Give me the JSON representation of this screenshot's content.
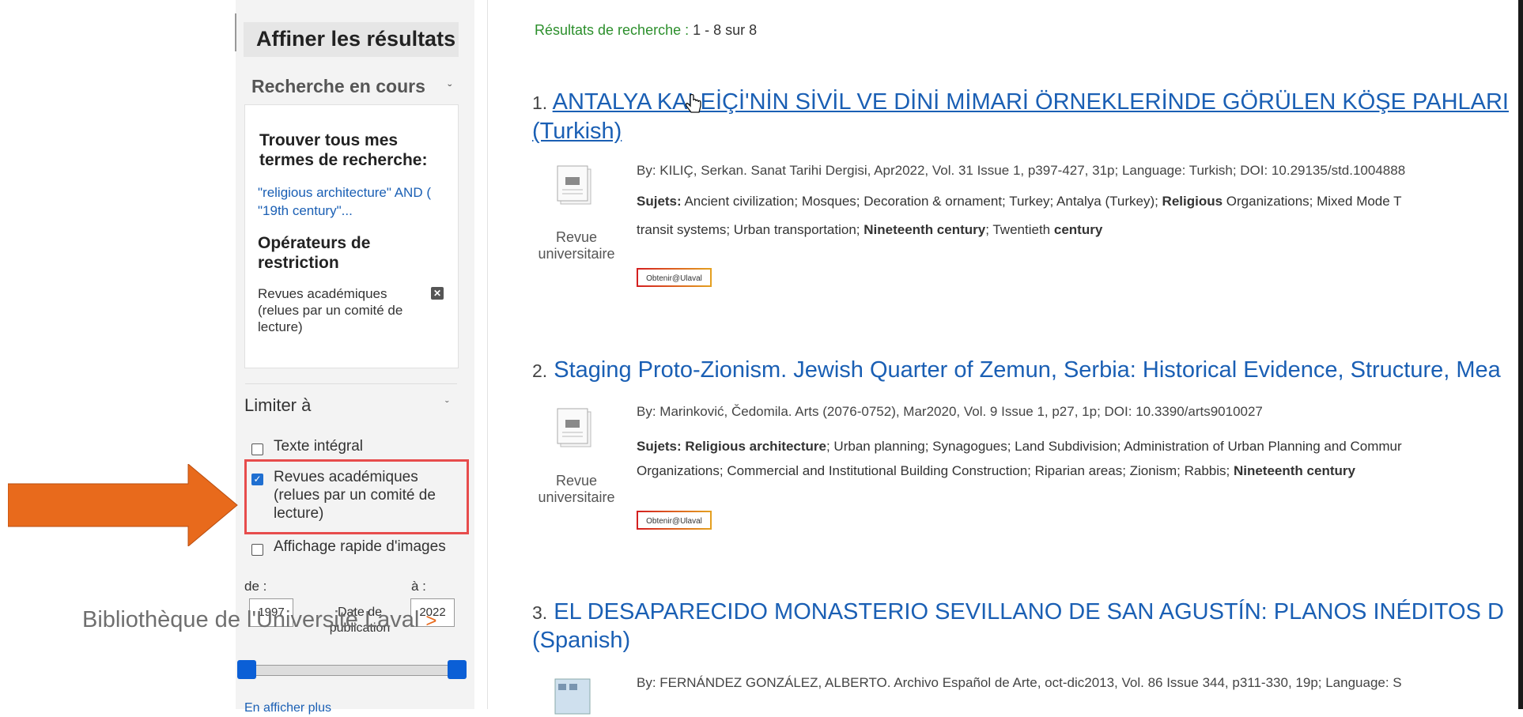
{
  "sidebar": {
    "refine_title": "Affiner les résultats",
    "current_search": "Recherche en cours",
    "find_all": "Trouver tous mes termes de recherche:",
    "query": "\"religious architecture\" AND ( \"19th century\"...",
    "operators_title": "Opérateurs de restriction",
    "restriction": "Revues académiques (relues par un comité de lecture)",
    "limit_title": "Limiter à",
    "options": [
      {
        "label": "Texte intégral",
        "checked": false
      },
      {
        "label": "Revues académiques (relues par un comité de lecture)",
        "checked": true
      },
      {
        "label": "Affichage rapide d'images",
        "checked": false
      }
    ],
    "from_label": "de :",
    "to_label": "à :",
    "from_year": "1997",
    "to_year": "2022",
    "date_label": "Date de publication",
    "show_more": "En afficher plus"
  },
  "overlay": {
    "library_text": "Bibliothèque de l'Université Laval",
    "library_arrow": ">",
    "highlight_color": "#e74c4c",
    "arrow_color": "#e86a1c"
  },
  "results": {
    "summary_label": "Résultats de recherche : ",
    "summary_range": "1 - 8 sur 8",
    "items": [
      {
        "index": "1.",
        "title": "ANTALYA KALEİÇİ'NİN SİVİL VE DİNİ MİMARİ ÖRNEKLERİNDE GÖRÜLEN KÖŞE PAHLARI",
        "title_line2": "(Turkish)",
        "meta": "By: KILIÇ, Serkan. Sanat Tarihi Dergisi, Apr2022, Vol. 31 Issue 1, p397-427, 31p; Language: Turkish; DOI: 10.29135/std.1004888",
        "subjects_label": "Sujets:",
        "subjects_1": " Ancient civilization; Mosques; Decoration & ornament; Turkey; Antalya (Turkey); ",
        "subjects_1b": "Religious",
        "subjects_1c": " Organizations; Mixed Mode T",
        "subjects_2": "transit systems; Urban transportation; ",
        "subjects_2b": "Nineteenth century",
        "subjects_2c": "; Twentieth ",
        "subjects_2d": "century",
        "type": "Revue universitaire",
        "link": "Obtenir@Ulaval"
      },
      {
        "index": "2.",
        "title": "Staging Proto-Zionism. Jewish Quarter of Zemun, Serbia: Historical Evidence, Structure, Mea",
        "meta": "By: Marinković, Čedomila. Arts (2076-0752), Mar2020, Vol. 9 Issue 1, p27, 1p; DOI: 10.3390/arts9010027",
        "subjects_label": "Sujets:",
        "subjects_1a": "Religious architecture",
        "subjects_1": "; Urban planning; Synagogues; Land Subdivision; Administration of Urban Planning and Commur",
        "subjects_2": "Organizations; Commercial and Institutional Building Construction; Riparian areas; Zionism; Rabbis; ",
        "subjects_2b": "Nineteenth century",
        "type": "Revue universitaire",
        "link": "Obtenir@Ulaval"
      },
      {
        "index": "3.",
        "title": "EL DESAPARECIDO MONASTERIO SEVILLANO DE SAN AGUSTÍN: PLANOS INÉDITOS D",
        "title_line2": "(Spanish)",
        "meta": "By: FERNÁNDEZ GONZÁLEZ, ALBERTO. Archivo Español de Arte, oct-dic2013, Vol. 86 Issue 344, p311-330, 19p; Language: S"
      }
    ]
  }
}
